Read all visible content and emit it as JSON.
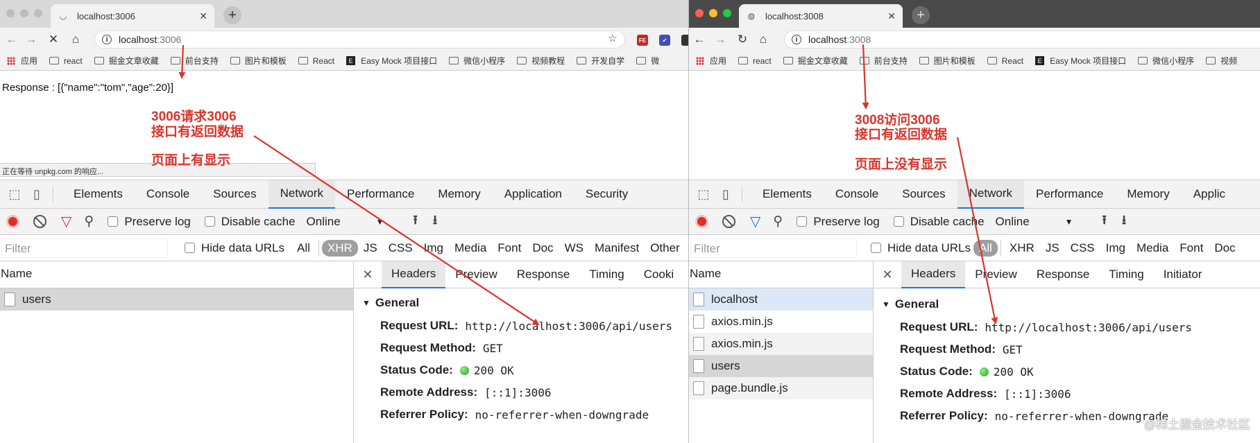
{
  "left": {
    "tab_title": "localhost:3006",
    "url_host": "localhost",
    "url_port": ":3006",
    "response_text": "Response : [{\"name\":\"tom\",\"age\":20}]",
    "status_text": "正在等待 unpkg.com 的响应...",
    "annotation": [
      "3006请求3006",
      "接口有返回数据",
      "页面上有显示"
    ],
    "devtools_tabs": [
      "Elements",
      "Console",
      "Sources",
      "Network",
      "Performance",
      "Memory",
      "Application",
      "Security"
    ],
    "active_tab": "Network",
    "type_filters": [
      "XHR",
      "JS",
      "CSS",
      "Img",
      "Media",
      "Font",
      "Doc",
      "WS",
      "Manifest",
      "Other"
    ],
    "selected_type": "XHR",
    "requests": [
      "users"
    ],
    "detail_tabs": [
      "Headers",
      "Preview",
      "Response",
      "Timing",
      "Cooki"
    ],
    "general": {
      "request_url": "http://localhost:3006/api/users",
      "request_method": "GET",
      "status_code": "200 OK",
      "remote_address": "[::1]:3006",
      "referrer_policy": "no-referrer-when-downgrade"
    }
  },
  "right": {
    "tab_title": "localhost:3008",
    "url_host": "localhost",
    "url_port": ":3008",
    "annotation": [
      "3008访问3006",
      "接口有返回数据",
      "页面上没有显示"
    ],
    "devtools_tabs": [
      "Elements",
      "Console",
      "Sources",
      "Network",
      "Performance",
      "Memory",
      "Applic"
    ],
    "active_tab": "Network",
    "type_filters": [
      "All",
      "XHR",
      "JS",
      "CSS",
      "Img",
      "Media",
      "Font",
      "Doc"
    ],
    "selected_type": "All",
    "requests": [
      "localhost",
      "axios.min.js",
      "axios.min.js",
      "users",
      "page.bundle.js"
    ],
    "detail_tabs": [
      "Headers",
      "Preview",
      "Response",
      "Timing",
      "Initiator"
    ],
    "general": {
      "request_url": "http://localhost:3006/api/users",
      "request_method": "GET",
      "status_code": "200 OK",
      "remote_address": "[::1]:3006",
      "referrer_policy": "no-referrer-when-downgrade"
    }
  },
  "bookmarks": [
    "应用",
    "react",
    "掘金文章收藏",
    "前台支持",
    "图片和模板",
    "React",
    "Easy Mock 项目接口",
    "微信小程序",
    "视频教程",
    "开发自学",
    "微"
  ],
  "bookmarks_right": [
    "应用",
    "react",
    "掘金文章收藏",
    "前台支持",
    "图片和模板",
    "React",
    "Easy Mock 项目接口",
    "微信小程序",
    "视频"
  ],
  "common": {
    "preserve_log": "Preserve log",
    "disable_cache": "Disable cache",
    "throttle": "Online",
    "filter_placeholder": "Filter",
    "hide_data_urls": "Hide data URLs",
    "all": "All",
    "name_header": "Name",
    "general_label": "General",
    "k_request_url": "Request URL:",
    "k_request_method": "Request Method:",
    "k_status_code": "Status Code:",
    "k_remote_address": "Remote Address:",
    "k_referrer_policy": "Referrer Policy:",
    "ext1": "FE"
  },
  "watermark": "@稀土掘金技术社区",
  "colors": {
    "annotation": "#d9352b",
    "record": "#d93025",
    "accent": "#1a73e8"
  }
}
